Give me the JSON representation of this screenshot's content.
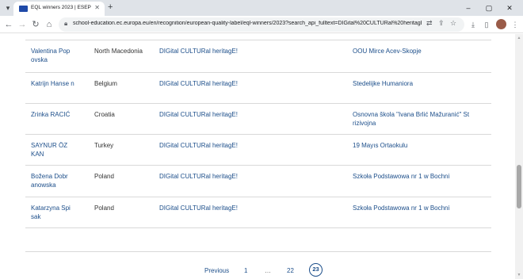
{
  "browser": {
    "tab_title": "EQL winners 2023 | ESEP",
    "tab_close": "✕",
    "new_tab": "+",
    "url": "school-education.ec.europa.eu/en/recognition/european-quality-label/eql-winners/2023?search_api_fulltext=DIGital%20CULTURal%20heritagE%2...",
    "window_controls": [
      "–",
      "▢",
      "✕"
    ]
  },
  "winners": [
    {
      "name": "Valentina Pop ovska",
      "country": "North Macedonia",
      "project": "DIGital CULTURal heritagE!",
      "school": "OOU Mirce Acev-Skopje"
    },
    {
      "name": "Katrijn Hanse n",
      "country": "Belgium",
      "project": "DIGital CULTURal heritagE!",
      "school": "Stedelijke Humaniora"
    },
    {
      "name": "Zrinka RACIĆ",
      "country": "Croatia",
      "project": "DIGital CULTURal heritagE!",
      "school": "Osnovna škola \"Ivana Brlić Mažuranić\" St rizivojna"
    },
    {
      "name": "SAYNUR ÖZ KAN",
      "country": "Turkey",
      "project": "DIGital CULTURal heritagE!",
      "school": "19 Mayıs Ortaokulu"
    },
    {
      "name": "Božena Dobr anowska",
      "country": "Poland",
      "project": "DIGital CULTURal heritagE!",
      "school": "Szkoła Podstawowa nr 1 w Bochni"
    },
    {
      "name": "Katarzyna Spi sak",
      "country": "Poland",
      "project": "DIGital CULTURal heritagE!",
      "school": "Szkoła Podstawowa nr 1 w Bochni"
    }
  ],
  "pagination": {
    "previous": "Previous",
    "first": "1",
    "ellipsis": "…",
    "prev_page": "22",
    "current": "23"
  }
}
